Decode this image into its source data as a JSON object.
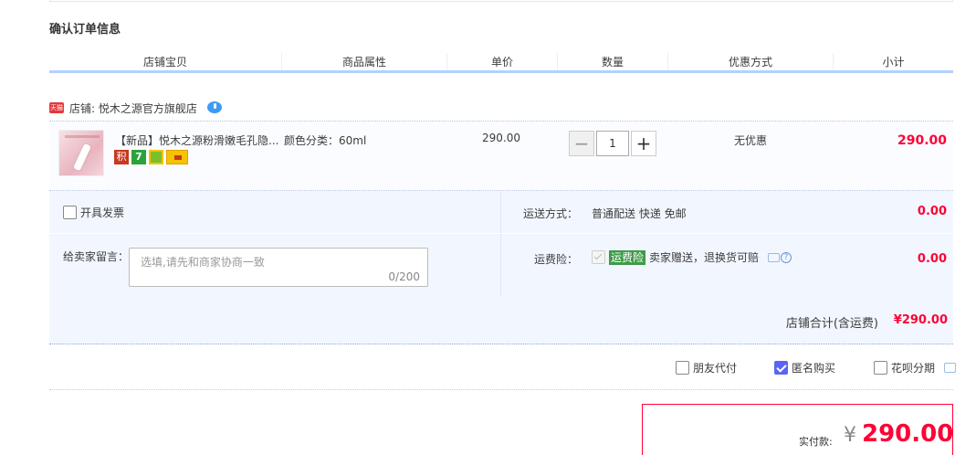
{
  "section_title": "确认订单信息",
  "table_headers": [
    "店铺宝贝",
    "商品属性",
    "单价",
    "数量",
    "优惠方式",
    "小计"
  ],
  "shop": {
    "badge": "天猫",
    "label": "店铺: 悦木之源官方旗舰店"
  },
  "item": {
    "title": "【新品】悦木之源粉滑嫩毛孔隐...",
    "badges": [
      "积",
      "7"
    ],
    "attribute": "颜色分类：60ml",
    "unit_price": "290.00",
    "quantity": "1",
    "qty_minus": "−",
    "qty_plus": "+",
    "discount": "无优惠",
    "subtotal": "290.00"
  },
  "invoice": {
    "label": "开具发票",
    "checked": false
  },
  "shipping": {
    "label": "运送方式：",
    "value": "普通配送 快递 免邮",
    "fee": "0.00"
  },
  "message": {
    "label": "给卖家留言：",
    "placeholder": "选填,请先和商家协商一致",
    "counter": "0/200"
  },
  "insurance": {
    "label": "运费险：",
    "tag": "运费险",
    "text": "卖家赠送，退换货可赔",
    "help": "?",
    "fee": "0.00"
  },
  "shop_total": {
    "label": "店铺合计(含运费)",
    "amount": "¥290.00"
  },
  "options": [
    {
      "label": "朋友代付",
      "checked": false
    },
    {
      "label": "匿名购买",
      "checked": true
    },
    {
      "label": "花呗分期",
      "checked": false
    }
  ],
  "payment": {
    "label": "实付款:",
    "currency": "¥",
    "amount": "290.00"
  },
  "colors": {
    "accent_red": "#ff0036",
    "header_rule": "#b2d1ff",
    "panel_bg": "#f2f7ff",
    "checkbox_checked": "#5c64f4",
    "insurance_green": "#3f9a48"
  }
}
